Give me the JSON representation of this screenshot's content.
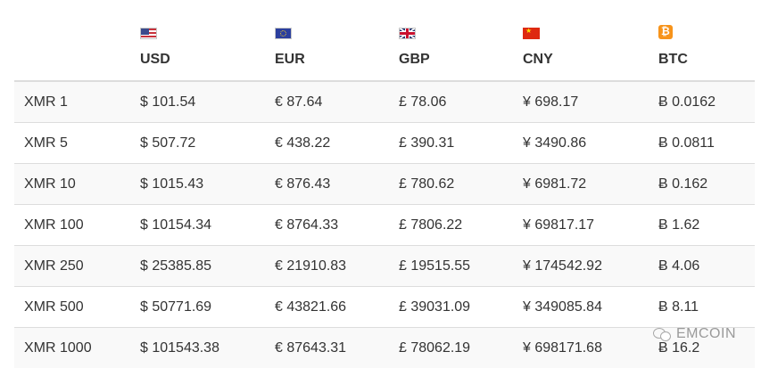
{
  "table": {
    "headers": [
      {
        "code": "USD",
        "flag": "us-flag-icon"
      },
      {
        "code": "EUR",
        "flag": "eu-flag-icon"
      },
      {
        "code": "GBP",
        "flag": "gb-flag-icon"
      },
      {
        "code": "CNY",
        "flag": "cn-flag-icon"
      },
      {
        "code": "BTC",
        "flag": "bitcoin-icon"
      }
    ],
    "rows": [
      {
        "label": "XMR 1",
        "values": [
          "$ 101.54",
          "€ 87.64",
          "£ 78.06",
          "¥ 698.17",
          "Ƀ 0.0162"
        ]
      },
      {
        "label": "XMR 5",
        "values": [
          "$ 507.72",
          "€ 438.22",
          "£ 390.31",
          "¥ 3490.86",
          "Ƀ 0.0811"
        ]
      },
      {
        "label": "XMR 10",
        "values": [
          "$ 1015.43",
          "€ 876.43",
          "£ 780.62",
          "¥ 6981.72",
          "Ƀ 0.162"
        ]
      },
      {
        "label": "XMR 100",
        "values": [
          "$ 10154.34",
          "€ 8764.33",
          "£ 7806.22",
          "¥ 69817.17",
          "Ƀ 1.62"
        ]
      },
      {
        "label": "XMR 250",
        "values": [
          "$ 25385.85",
          "€ 21910.83",
          "£ 19515.55",
          "¥ 174542.92",
          "Ƀ 4.06"
        ]
      },
      {
        "label": "XMR 500",
        "values": [
          "$ 50771.69",
          "€ 43821.66",
          "£ 39031.09",
          "¥ 349085.84",
          "Ƀ 8.11"
        ]
      },
      {
        "label": "XMR 1000",
        "values": [
          "$ 101543.38",
          "€ 87643.31",
          "£ 78062.19",
          "¥ 698171.68",
          "Ƀ 16.2"
        ]
      }
    ]
  },
  "watermark": {
    "text": "EMCOIN",
    "icon": "wechat-icon"
  },
  "colors": {
    "stripe": "#f9f9f9",
    "border": "#dddddd",
    "text": "#333333"
  }
}
